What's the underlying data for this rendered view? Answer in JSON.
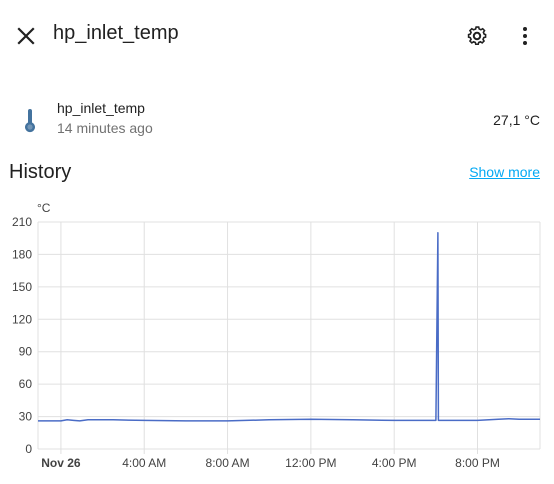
{
  "header": {
    "title": "hp_inlet_temp",
    "icons": {
      "close": "close-icon",
      "settings": "gear-icon",
      "more": "dots-vertical-icon"
    }
  },
  "entity": {
    "name": "hp_inlet_temp",
    "last_changed": "14 minutes ago",
    "value": "27,1 °C",
    "icon": "thermometer-icon",
    "icon_color": "#44739e"
  },
  "history": {
    "title": "History",
    "show_more_label": "Show more",
    "link_color": "#03a9f4"
  },
  "chart_data": {
    "type": "line",
    "unit": "°C",
    "ylim": [
      0,
      210
    ],
    "y_ticks": [
      "210",
      "180",
      "150",
      "120",
      "90",
      "60",
      "30",
      "0"
    ],
    "x_ticks": [
      {
        "label": "Nov 26",
        "bold": true
      },
      {
        "label": "4:00 AM",
        "bold": false
      },
      {
        "label": "8:00 AM",
        "bold": false
      },
      {
        "label": "12:00 PM",
        "bold": false
      },
      {
        "label": "4:00 PM",
        "bold": false
      },
      {
        "label": "8:00 PM",
        "bold": false
      }
    ],
    "x_range_hours": [
      -1.1,
      23.0
    ],
    "x_tick_hours": [
      0,
      4,
      8,
      12,
      16,
      20
    ],
    "series": [
      {
        "color": "#4a6cc6",
        "points": [
          [
            -1.1,
            26.0
          ],
          [
            0.0,
            26.0
          ],
          [
            0.3,
            27.0
          ],
          [
            0.6,
            26.5
          ],
          [
            0.9,
            26.0
          ],
          [
            1.3,
            27.0
          ],
          [
            2.5,
            27.0
          ],
          [
            4.0,
            26.5
          ],
          [
            6.0,
            26.0
          ],
          [
            8.0,
            26.0
          ],
          [
            10.0,
            27.0
          ],
          [
            12.0,
            27.5
          ],
          [
            14.0,
            27.0
          ],
          [
            16.0,
            26.5
          ],
          [
            18.0,
            26.5
          ],
          [
            18.1,
            200.0
          ],
          [
            18.12,
            26.5
          ],
          [
            20.0,
            26.5
          ],
          [
            21.0,
            27.5
          ],
          [
            21.5,
            28.0
          ],
          [
            22.0,
            27.5
          ],
          [
            23.0,
            27.5
          ]
        ]
      }
    ],
    "grid": true,
    "grid_color": "#e0e0e0"
  }
}
